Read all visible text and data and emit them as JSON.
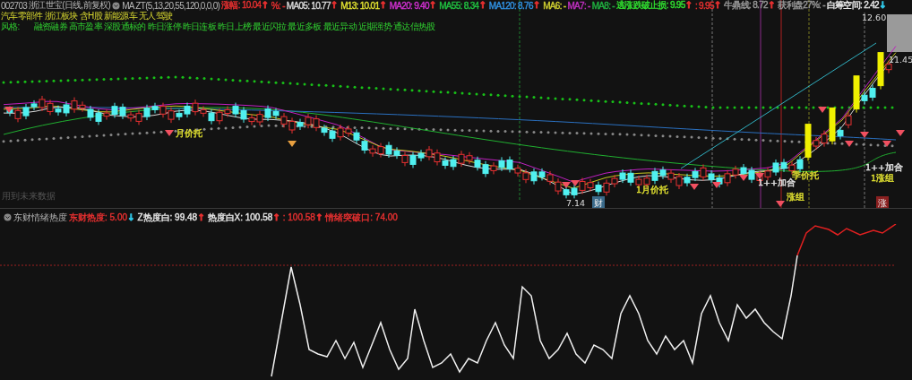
{
  "header": {
    "code": "002703",
    "name": "浙江世宝",
    "period": "(日线,前复权)",
    "indicator": "MA ZT(5,13,20,55,120,0,0,0)",
    "items": [
      {
        "label": "涨幅:",
        "value": "10.04",
        "arrow": {
          "text": "↑",
          "color": "#e83030"
        },
        "color": "#e83030"
      },
      {
        "label": "%:",
        "value": "-",
        "color": "#e83030"
      },
      {
        "label": "MA05:",
        "value": "10.77",
        "arrow": {
          "text": "↑",
          "color": "#e83030"
        },
        "color": "#d8d8d8"
      },
      {
        "label": "M13:",
        "value": "10.01",
        "arrow": {
          "text": "↑",
          "color": "#e83030"
        },
        "color": "#e0e030"
      },
      {
        "label": "MA20:",
        "value": "9.40",
        "arrow": {
          "text": "↑",
          "color": "#e83030"
        },
        "color": "#d030d0"
      },
      {
        "label": "MA55:",
        "value": "8.34",
        "arrow": {
          "text": "↑",
          "color": "#e83030"
        },
        "color": "#20c040"
      },
      {
        "label": "MA120:",
        "value": "8.76",
        "arrow": {
          "text": "↑",
          "color": "#e83030"
        },
        "color": "#3090e0"
      },
      {
        "label": "MA6:",
        "value": "-",
        "color": "#d0d030"
      },
      {
        "label": "MA7:",
        "value": "-",
        "color": "#c030c0"
      },
      {
        "label": "MA8:",
        "value": "-",
        "color": "#20b040"
      },
      {
        "label": "逃涨跌破止损:",
        "value": "9.95",
        "arrow": {
          "text": "↑",
          "color": "#e83030"
        },
        "color": "#30e030"
      },
      {
        "label": ":",
        "value": "9.95",
        "arrow": {
          "text": "↑",
          "color": "#e83030"
        },
        "color": "#e83030"
      },
      {
        "label": "牛鼎线:",
        "value": "8.72",
        "arrow": {
          "text": "↑",
          "color": "#e83030"
        },
        "color": "#9a9a9a"
      },
      {
        "label": "获利盘27%:",
        "value": "-",
        "color": "#9a9a9a"
      },
      {
        "label": "白筹空间:",
        "value": "2.42",
        "arrow": {
          "text": "↓",
          "color": "#30c8e8"
        },
        "color": "#e8e8e8"
      }
    ]
  },
  "tags": [
    "汽车零部件",
    "浙江板块",
    "含H股",
    "新能源车",
    "无人驾驶"
  ],
  "style": {
    "label": "风格:",
    "items": [
      "融资融券",
      "高市盈率",
      "深股通标的",
      "昨日涨停",
      "昨日连板",
      "昨日上榜",
      "最近闪拉",
      "最近多板",
      "最近异动",
      "近期强势",
      "通达信热股"
    ]
  },
  "chart": {
    "price_high": "12.60",
    "price_mid": "11.45",
    "price_low": "7.14",
    "future_note": "用到未来数据",
    "annotations": [
      {
        "text": "月价托",
        "color": "#e0e030"
      },
      {
        "text": "1月价托",
        "color": "#e0e030"
      },
      {
        "text": "季价托",
        "color": "#e0e030"
      },
      {
        "text": "1++加合",
        "color": "#e8e8e8"
      },
      {
        "text": "涨组",
        "color": "#e0e030"
      },
      {
        "text": "1++加合",
        "color": "#e8e8e8"
      },
      {
        "text": "1涨组",
        "color": "#e0e030"
      }
    ],
    "badges": [
      {
        "text": "财",
        "color": "#3a6a8a"
      },
      {
        "text": "涨",
        "color": "#8a2020"
      }
    ]
  },
  "indicator": {
    "name": "东财情绪热度",
    "items": [
      {
        "label": "东财热度:",
        "value": "5.00",
        "arrow": {
          "text": "↓",
          "color": "#30c8e8"
        },
        "color": "#e83030"
      },
      {
        "label": "Z热度白:",
        "value": "99.48",
        "arrow": {
          "text": "↑",
          "color": "#e83030"
        },
        "color": "#e8e8e8"
      },
      {
        "label": "热度白X:",
        "value": "100.58",
        "arrow": {
          "text": "↑",
          "color": "#e83030"
        },
        "color": "#e8e8e8"
      },
      {
        "label": ":",
        "value": "100.58",
        "arrow": {
          "text": "↑",
          "color": "#e83030"
        },
        "color": "#e83030"
      },
      {
        "label": "情绪突破口:",
        "value": "74.00",
        "color": "#e83030"
      }
    ]
  }
}
